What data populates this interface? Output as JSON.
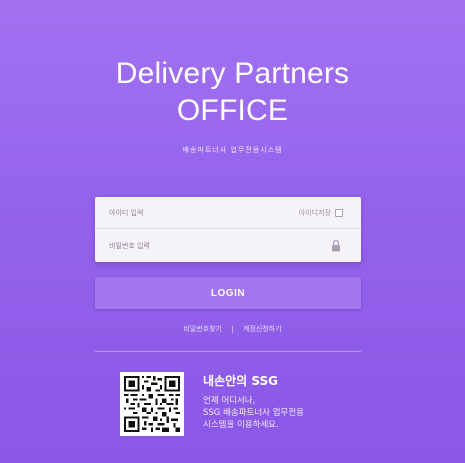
{
  "header": {
    "title_line1": "Delivery Partners",
    "title_line2": "OFFICE",
    "subtitle": "배송파트너사 업무전용시스템"
  },
  "login_form": {
    "id_placeholder": "아이디 입력",
    "password_placeholder": "비밀번호 입력",
    "save_id_label": "아이디저장",
    "login_button_label": "LOGIN"
  },
  "links": {
    "find_password": "비밀번호찾기",
    "account_request": "계정신청하기"
  },
  "app_promo": {
    "title": "내손안의 SSG",
    "desc_line1": "언제 어디서나,",
    "desc_line2": "SSG 배송파트너사 업무전용",
    "desc_line3": "시스템을 이용하세요."
  },
  "colors": {
    "background": "#9463ec",
    "card": "#f6f3f8",
    "button": "#a176ee"
  },
  "icons": {
    "lock": "lock-icon",
    "checkbox": "checkbox-icon",
    "qr": "qr-code-icon"
  }
}
